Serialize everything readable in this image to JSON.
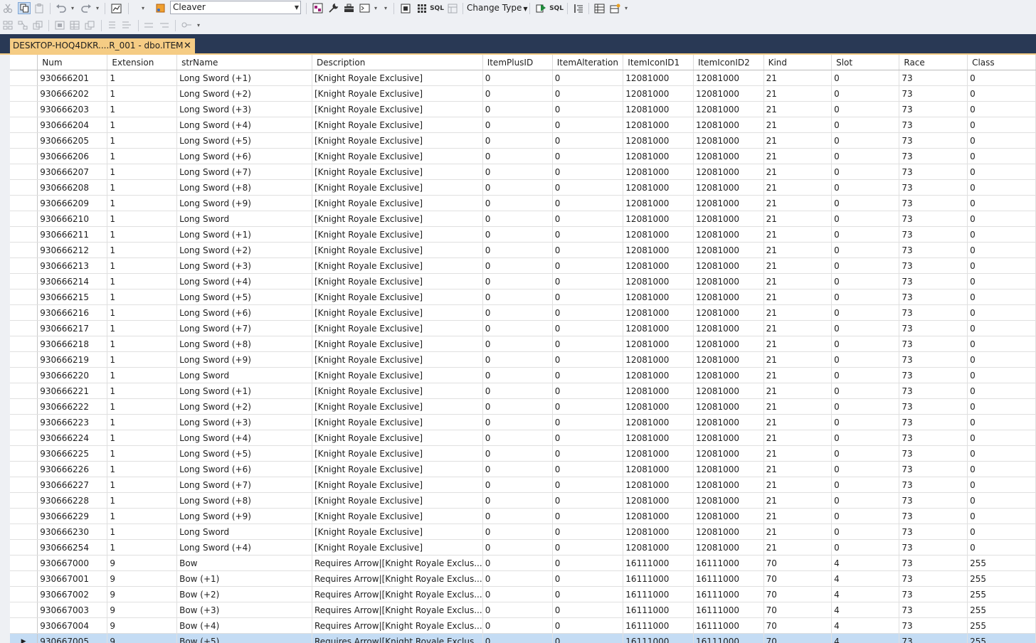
{
  "toolbar": {
    "view_combo_value": "Cleaver",
    "change_type_label": "Change Type",
    "sql_label": "SQL",
    "sql_label2": "SQL",
    "icons": [
      "cut-icon",
      "copy-icon",
      "paste-icon",
      "undo-icon",
      "redo-icon",
      "properties-icon",
      "solution-explorer-icon",
      "diagram-pane-icon",
      "criteria-pane-icon",
      "sql-pane-icon",
      "results-pane-icon",
      "execute-sql-icon",
      "verify-sql-icon",
      "group-by-icon",
      "add-table-icon",
      "add-derived-table-icon"
    ]
  },
  "tab": {
    "title": "DESKTOP-HOQ4DKR....R_001 - dbo.ITEM",
    "pin_glyph": "⊣",
    "close_glyph": "✕"
  },
  "grid": {
    "columns": [
      "Num",
      "Extension",
      "strName",
      "Description",
      "ItemPlusID",
      "ItemAlteration",
      "ItemIconID1",
      "ItemIconID2",
      "Kind",
      "Slot",
      "Race",
      "Class"
    ],
    "rows": [
      [
        "930666201",
        "1",
        "Long Sword (+1)",
        "[Knight Royale Exclusive]",
        "0",
        "0",
        "12081000",
        "12081000",
        "21",
        "0",
        "73",
        "0"
      ],
      [
        "930666202",
        "1",
        "Long Sword (+2)",
        "[Knight Royale Exclusive]",
        "0",
        "0",
        "12081000",
        "12081000",
        "21",
        "0",
        "73",
        "0"
      ],
      [
        "930666203",
        "1",
        "Long Sword (+3)",
        "[Knight Royale Exclusive]",
        "0",
        "0",
        "12081000",
        "12081000",
        "21",
        "0",
        "73",
        "0"
      ],
      [
        "930666204",
        "1",
        "Long Sword (+4)",
        "[Knight Royale Exclusive]",
        "0",
        "0",
        "12081000",
        "12081000",
        "21",
        "0",
        "73",
        "0"
      ],
      [
        "930666205",
        "1",
        "Long Sword (+5)",
        "[Knight Royale Exclusive]",
        "0",
        "0",
        "12081000",
        "12081000",
        "21",
        "0",
        "73",
        "0"
      ],
      [
        "930666206",
        "1",
        "Long Sword (+6)",
        "[Knight Royale Exclusive]",
        "0",
        "0",
        "12081000",
        "12081000",
        "21",
        "0",
        "73",
        "0"
      ],
      [
        "930666207",
        "1",
        "Long Sword (+7)",
        "[Knight Royale Exclusive]",
        "0",
        "0",
        "12081000",
        "12081000",
        "21",
        "0",
        "73",
        "0"
      ],
      [
        "930666208",
        "1",
        "Long Sword (+8)",
        "[Knight Royale Exclusive]",
        "0",
        "0",
        "12081000",
        "12081000",
        "21",
        "0",
        "73",
        "0"
      ],
      [
        "930666209",
        "1",
        "Long Sword (+9)",
        "[Knight Royale Exclusive]",
        "0",
        "0",
        "12081000",
        "12081000",
        "21",
        "0",
        "73",
        "0"
      ],
      [
        "930666210",
        "1",
        "Long Sword",
        "[Knight Royale Exclusive]",
        "0",
        "0",
        "12081000",
        "12081000",
        "21",
        "0",
        "73",
        "0"
      ],
      [
        "930666211",
        "1",
        "Long Sword (+1)",
        "[Knight Royale Exclusive]",
        "0",
        "0",
        "12081000",
        "12081000",
        "21",
        "0",
        "73",
        "0"
      ],
      [
        "930666212",
        "1",
        "Long Sword (+2)",
        "[Knight Royale Exclusive]",
        "0",
        "0",
        "12081000",
        "12081000",
        "21",
        "0",
        "73",
        "0"
      ],
      [
        "930666213",
        "1",
        "Long Sword (+3)",
        "[Knight Royale Exclusive]",
        "0",
        "0",
        "12081000",
        "12081000",
        "21",
        "0",
        "73",
        "0"
      ],
      [
        "930666214",
        "1",
        "Long Sword (+4)",
        "[Knight Royale Exclusive]",
        "0",
        "0",
        "12081000",
        "12081000",
        "21",
        "0",
        "73",
        "0"
      ],
      [
        "930666215",
        "1",
        "Long Sword (+5)",
        "[Knight Royale Exclusive]",
        "0",
        "0",
        "12081000",
        "12081000",
        "21",
        "0",
        "73",
        "0"
      ],
      [
        "930666216",
        "1",
        "Long Sword (+6)",
        "[Knight Royale Exclusive]",
        "0",
        "0",
        "12081000",
        "12081000",
        "21",
        "0",
        "73",
        "0"
      ],
      [
        "930666217",
        "1",
        "Long Sword (+7)",
        "[Knight Royale Exclusive]",
        "0",
        "0",
        "12081000",
        "12081000",
        "21",
        "0",
        "73",
        "0"
      ],
      [
        "930666218",
        "1",
        "Long Sword (+8)",
        "[Knight Royale Exclusive]",
        "0",
        "0",
        "12081000",
        "12081000",
        "21",
        "0",
        "73",
        "0"
      ],
      [
        "930666219",
        "1",
        "Long Sword (+9)",
        "[Knight Royale Exclusive]",
        "0",
        "0",
        "12081000",
        "12081000",
        "21",
        "0",
        "73",
        "0"
      ],
      [
        "930666220",
        "1",
        "Long Sword",
        "[Knight Royale Exclusive]",
        "0",
        "0",
        "12081000",
        "12081000",
        "21",
        "0",
        "73",
        "0"
      ],
      [
        "930666221",
        "1",
        "Long Sword (+1)",
        "[Knight Royale Exclusive]",
        "0",
        "0",
        "12081000",
        "12081000",
        "21",
        "0",
        "73",
        "0"
      ],
      [
        "930666222",
        "1",
        "Long Sword (+2)",
        "[Knight Royale Exclusive]",
        "0",
        "0",
        "12081000",
        "12081000",
        "21",
        "0",
        "73",
        "0"
      ],
      [
        "930666223",
        "1",
        "Long Sword (+3)",
        "[Knight Royale Exclusive]",
        "0",
        "0",
        "12081000",
        "12081000",
        "21",
        "0",
        "73",
        "0"
      ],
      [
        "930666224",
        "1",
        "Long Sword (+4)",
        "[Knight Royale Exclusive]",
        "0",
        "0",
        "12081000",
        "12081000",
        "21",
        "0",
        "73",
        "0"
      ],
      [
        "930666225",
        "1",
        "Long Sword (+5)",
        "[Knight Royale Exclusive]",
        "0",
        "0",
        "12081000",
        "12081000",
        "21",
        "0",
        "73",
        "0"
      ],
      [
        "930666226",
        "1",
        "Long Sword (+6)",
        "[Knight Royale Exclusive]",
        "0",
        "0",
        "12081000",
        "12081000",
        "21",
        "0",
        "73",
        "0"
      ],
      [
        "930666227",
        "1",
        "Long Sword (+7)",
        "[Knight Royale Exclusive]",
        "0",
        "0",
        "12081000",
        "12081000",
        "21",
        "0",
        "73",
        "0"
      ],
      [
        "930666228",
        "1",
        "Long Sword (+8)",
        "[Knight Royale Exclusive]",
        "0",
        "0",
        "12081000",
        "12081000",
        "21",
        "0",
        "73",
        "0"
      ],
      [
        "930666229",
        "1",
        "Long Sword (+9)",
        "[Knight Royale Exclusive]",
        "0",
        "0",
        "12081000",
        "12081000",
        "21",
        "0",
        "73",
        "0"
      ],
      [
        "930666230",
        "1",
        "Long Sword",
        "[Knight Royale Exclusive]",
        "0",
        "0",
        "12081000",
        "12081000",
        "21",
        "0",
        "73",
        "0"
      ],
      [
        "930666254",
        "1",
        "Long Sword (+4)",
        "[Knight Royale Exclusive]",
        "0",
        "0",
        "12081000",
        "12081000",
        "21",
        "0",
        "73",
        "0"
      ],
      [
        "930667000",
        "9",
        "Bow",
        "Requires Arrow|[Knight Royale Exclus...",
        "0",
        "0",
        "16111000",
        "16111000",
        "70",
        "4",
        "73",
        "255"
      ],
      [
        "930667001",
        "9",
        "Bow (+1)",
        "Requires Arrow|[Knight Royale Exclus...",
        "0",
        "0",
        "16111000",
        "16111000",
        "70",
        "4",
        "73",
        "255"
      ],
      [
        "930667002",
        "9",
        "Bow (+2)",
        "Requires Arrow|[Knight Royale Exclus...",
        "0",
        "0",
        "16111000",
        "16111000",
        "70",
        "4",
        "73",
        "255"
      ],
      [
        "930667003",
        "9",
        "Bow (+3)",
        "Requires Arrow|[Knight Royale Exclus...",
        "0",
        "0",
        "16111000",
        "16111000",
        "70",
        "4",
        "73",
        "255"
      ],
      [
        "930667004",
        "9",
        "Bow (+4)",
        "Requires Arrow|[Knight Royale Exclus...",
        "0",
        "0",
        "16111000",
        "16111000",
        "70",
        "4",
        "73",
        "255"
      ],
      [
        "930667005",
        "9",
        "Bow (+5)",
        "Requires Arrow|[Knight Royale Exclus...",
        "0",
        "0",
        "16111000",
        "16111000",
        "70",
        "4",
        "73",
        "255"
      ]
    ],
    "selected_row_index": 36,
    "current_row_glyph": "▶"
  }
}
